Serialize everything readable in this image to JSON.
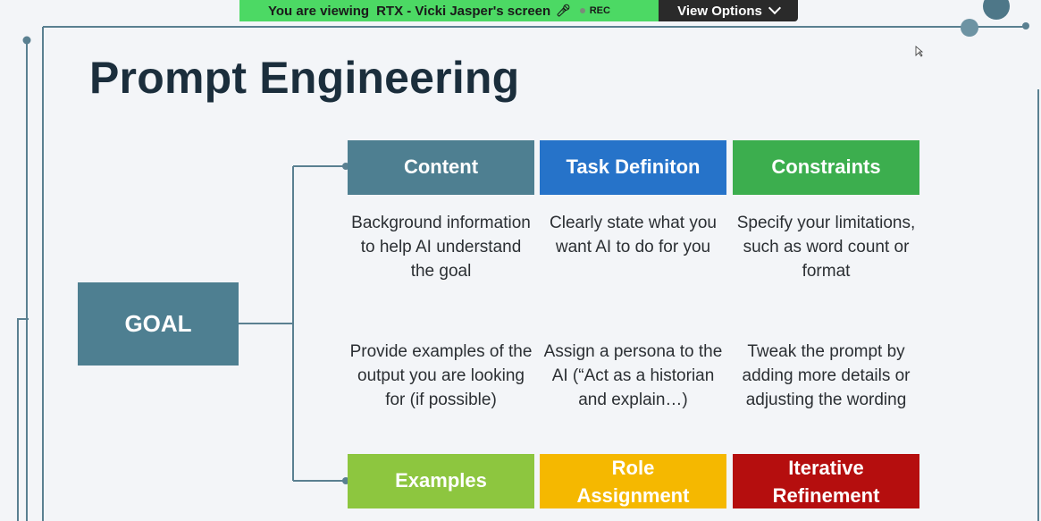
{
  "banner": {
    "viewing_label": "You are viewing",
    "presenter": "RTX - Vicki Jasper's screen",
    "rec_label": "REC",
    "view_options_label": "View Options"
  },
  "slide": {
    "title": "Prompt Engineering",
    "goal_label": "GOAL",
    "top_row": [
      {
        "label": "Content",
        "color": "#4e7f91",
        "description": "Background information to help AI understand the goal"
      },
      {
        "label": "Task Definiton",
        "color": "#2673c9",
        "description": "Clearly state what you want AI to do for you"
      },
      {
        "label": "Constraints",
        "color": "#3cae4e",
        "description": "Specify your limitations, such as word count or format"
      }
    ],
    "bottom_row": [
      {
        "label": "Examples",
        "color": "#8dc63f",
        "description": "Provide examples of the output you are looking for (if possible)"
      },
      {
        "label": "Role Assignment",
        "color": "#f5b800",
        "description": "Assign a persona to the AI (“Act as a historian and explain…)"
      },
      {
        "label": "Iterative Refinement",
        "color": "#b50e0e",
        "description": "Tweak the prompt by adding more details or adjusting the wording"
      }
    ]
  },
  "colors": {
    "line": "#5a8091",
    "title": "#1b2e3c",
    "background": "#f3f5f8",
    "banner_green": "#4cd964",
    "banner_dark": "#2a2a2a"
  }
}
